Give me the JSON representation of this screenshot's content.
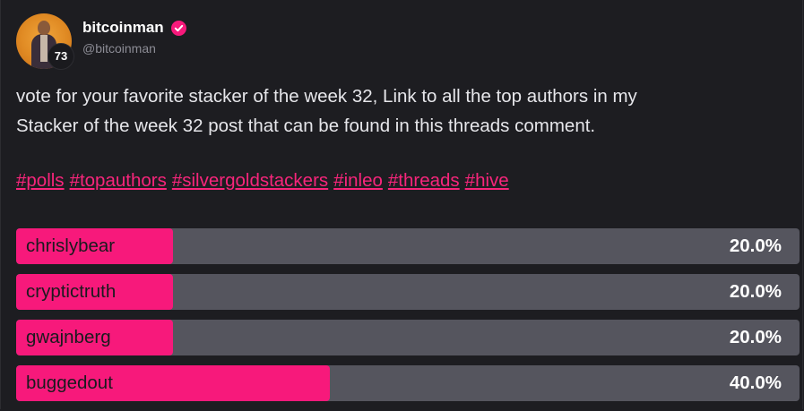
{
  "author": {
    "display_name": "bitcoinman",
    "handle": "@bitcoinman",
    "reputation": "73"
  },
  "post": {
    "text_line1": "vote for your favorite stacker of the week 32, Link to all the top authors in my",
    "text_line2": "Stacker of the week 32 post that can be found in this threads comment."
  },
  "tags": [
    "#polls",
    "#topauthors",
    "#silvergoldstackers",
    "#inleo",
    "#threads",
    "#hive"
  ],
  "poll": {
    "options": [
      {
        "label": "chrislybear",
        "percent_text": "20.0%",
        "percent": 20.0
      },
      {
        "label": "cryptictruth",
        "percent_text": "20.0%",
        "percent": 20.0
      },
      {
        "label": "gwajnberg",
        "percent_text": "20.0%",
        "percent": 20.0
      },
      {
        "label": "buggedout",
        "percent_text": "40.0%",
        "percent": 40.0
      }
    ]
  },
  "colors": {
    "accent": "#f7197b",
    "background": "#1d1d21",
    "bar_track": "#55555e",
    "text_muted": "#8c8c95"
  },
  "icons": {
    "verified": "verified-check-icon"
  }
}
